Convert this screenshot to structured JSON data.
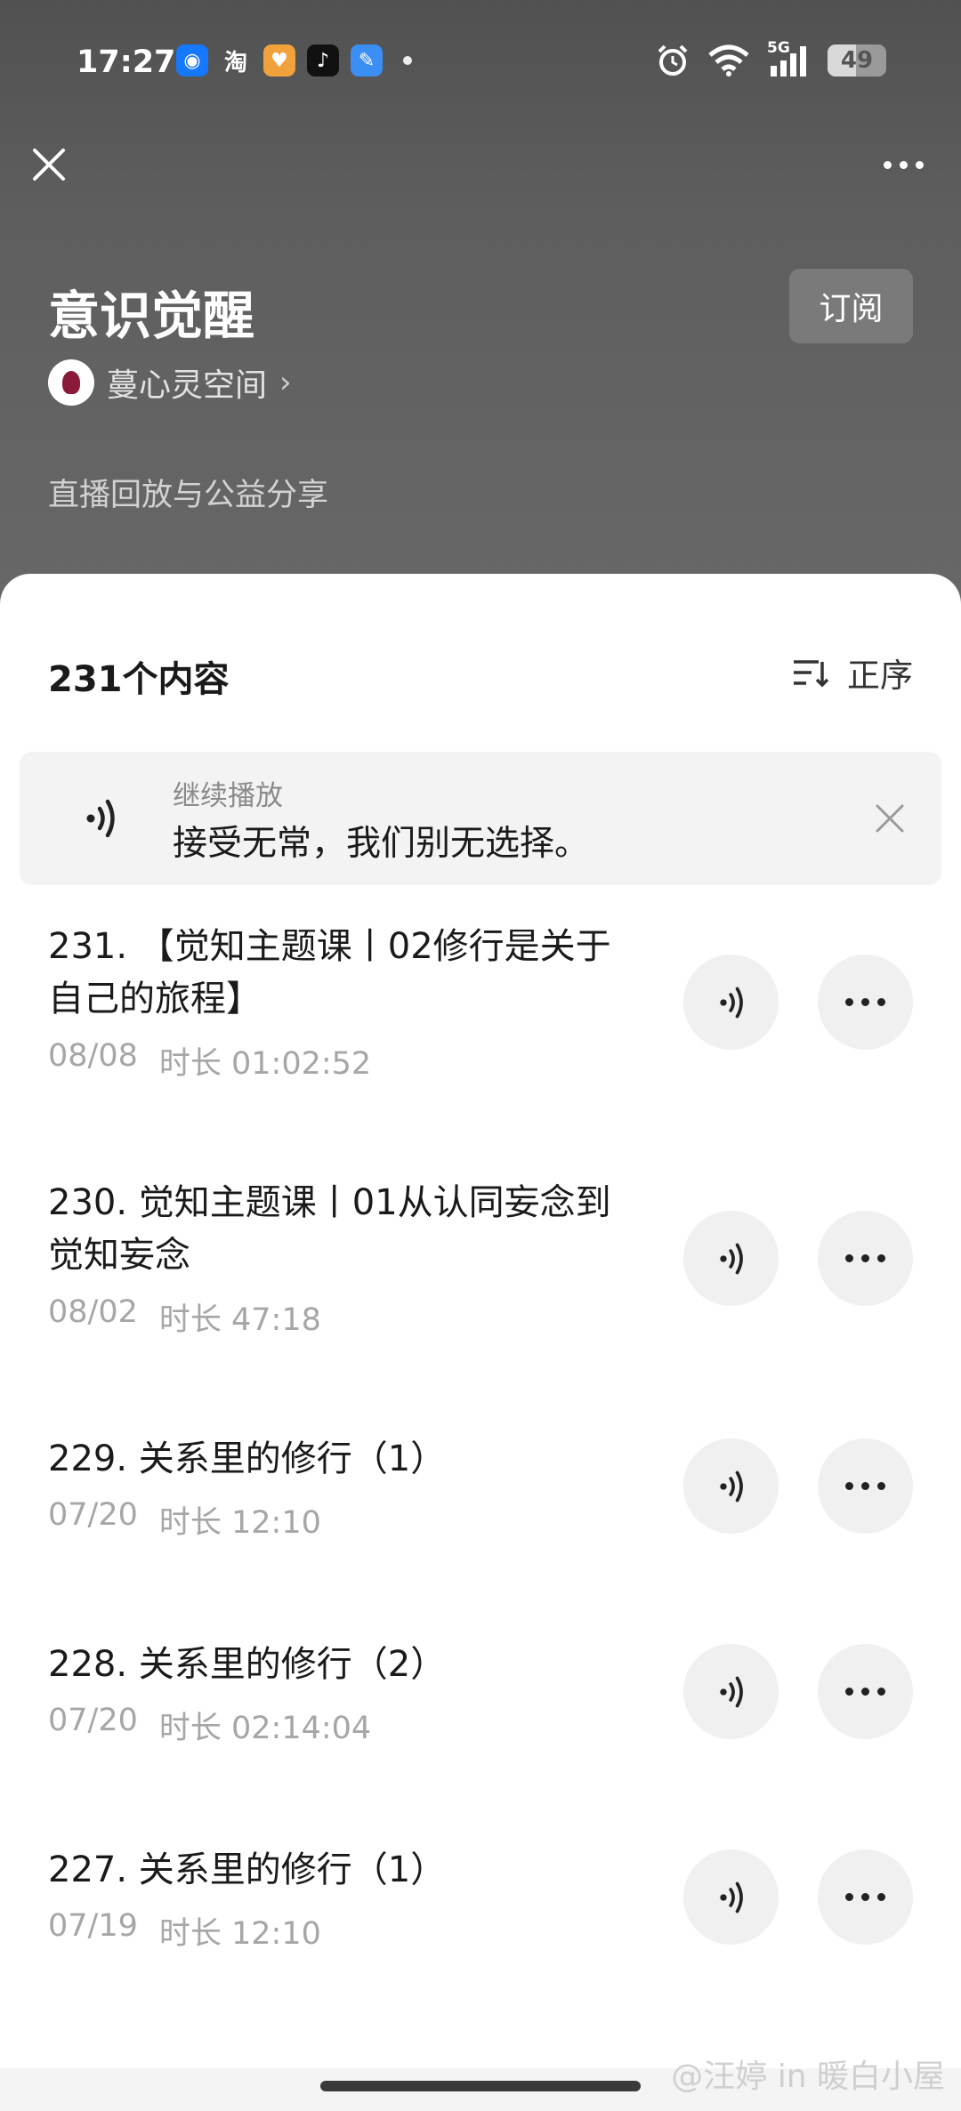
{
  "status_bar": {
    "time": "17:27",
    "apps": [
      {
        "icon": "app-blue-circle-icon",
        "glyph": "◉",
        "color": "#1677ff"
      },
      {
        "icon": "taobao-icon",
        "glyph": "淘",
        "color": "transparent"
      },
      {
        "icon": "app-orange-icon",
        "glyph": "♥",
        "color": "#f2a23c"
      },
      {
        "icon": "tiktok-icon",
        "glyph": "♪",
        "color": "#111111"
      },
      {
        "icon": "app-feather-icon",
        "glyph": "✎",
        "color": "#3b8ef3"
      }
    ],
    "network": "5G",
    "battery": "49",
    "battery_level": 0.49
  },
  "header": {
    "title": "意识觉醒",
    "subscribe_label": "订阅",
    "author": "蔓心灵空间",
    "description": "直播回放与公益分享"
  },
  "list": {
    "count_label": "231个内容",
    "sort_label": "正序",
    "resume": {
      "label": "继续播放",
      "title": "接受无常，我们别无选择。"
    },
    "episodes": [
      {
        "title": "231. 【觉知主题课丨02修行是关于自己的旅程】",
        "date": "08/08",
        "duration": "时长 01:02:52"
      },
      {
        "title": "230. 觉知主题课丨01从认同妄念到觉知妄念",
        "date": "08/02",
        "duration": "时长 47:18"
      },
      {
        "title": "229. 关系里的修行（1）",
        "date": "07/20",
        "duration": "时长 12:10"
      },
      {
        "title": "228. 关系里的修行（2）",
        "date": "07/20",
        "duration": "时长 02:14:04"
      },
      {
        "title": "227. 关系里的修行（1）",
        "date": "07/19",
        "duration": "时长 12:10"
      }
    ]
  },
  "watermark": "@汪婷 in 暖白小屋"
}
